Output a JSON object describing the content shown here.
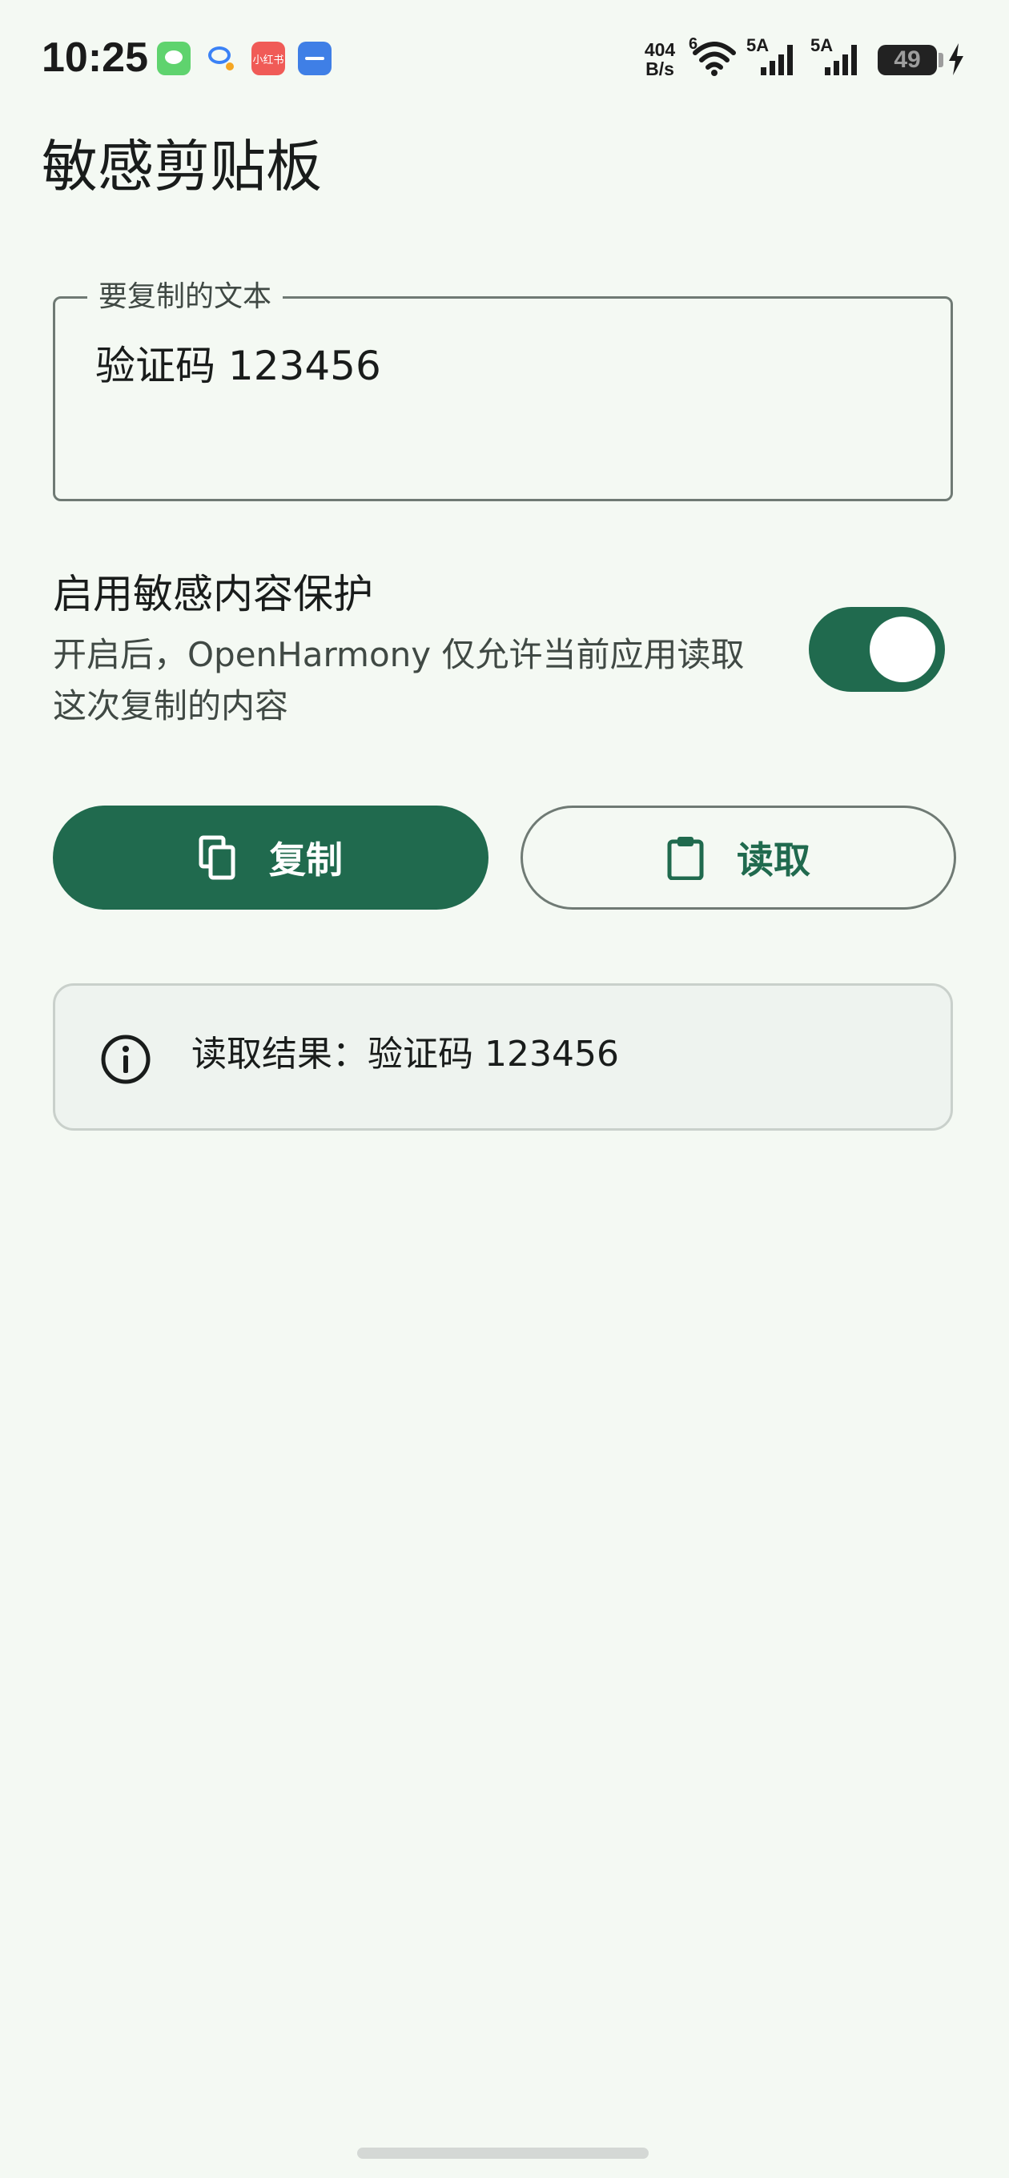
{
  "status_bar": {
    "time": "10:25",
    "net_speed_value": "404",
    "net_speed_unit": "B/s",
    "wifi_badge": "6",
    "signal1_label": "5A",
    "signal2_label": "5A",
    "battery_level": "49",
    "redbook_label": "小红书"
  },
  "header": {
    "title": "敏感剪贴板"
  },
  "text_field": {
    "label": "要复制的文本",
    "value": "验证码 123456"
  },
  "protection": {
    "title": "启用敏感内容保护",
    "description": "开启后，OpenHarmony 仅允许当前应用读取这次复制的内容",
    "enabled": true
  },
  "buttons": {
    "copy_label": "复制",
    "read_label": "读取"
  },
  "result": {
    "text": "读取结果：验证码 123456"
  },
  "colors": {
    "primary": "#206a4e",
    "background": "#f4f9f3",
    "outline": "#6f7a74",
    "result_surface": "#eef3ef"
  },
  "icons": {
    "copy": "copy-icon",
    "read": "clipboard-icon",
    "info": "info-icon"
  }
}
